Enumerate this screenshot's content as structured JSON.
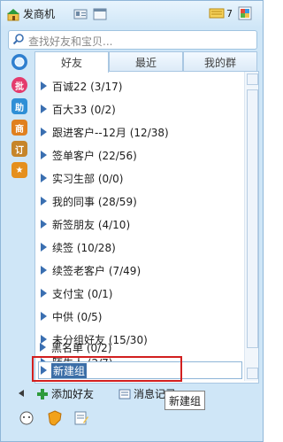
{
  "topbar": {
    "title": "发商机",
    "badge_count": "7"
  },
  "search": {
    "placeholder": "查找好友和宝贝..."
  },
  "side": {
    "pi_label": "批",
    "zhu_label": "助",
    "shang_label": "商",
    "gong_label": "订",
    "star_label": "★"
  },
  "tabs": [
    {
      "label": "好友"
    },
    {
      "label": "最近"
    },
    {
      "label": "我的群"
    }
  ],
  "groups": [
    {
      "label": "百诚22 (3/17)"
    },
    {
      "label": "百大33 (0/2)"
    },
    {
      "label": "跟进客户--12月 (12/38)"
    },
    {
      "label": "签单客户 (22/56)"
    },
    {
      "label": "实习生部 (0/0)"
    },
    {
      "label": "我的同事 (28/59)"
    },
    {
      "label": "新签朋友 (4/10)"
    },
    {
      "label": "续签 (10/28)"
    },
    {
      "label": "续签老客户 (7/49)"
    },
    {
      "label": "支付宝 (0/1)"
    },
    {
      "label": "中供 (0/5)"
    },
    {
      "label": "未分组好友 (15/30)"
    },
    {
      "label": "陌生人 (2/7)"
    },
    {
      "label": "黑名单 (0/2)"
    }
  ],
  "edit": {
    "value": "新建组"
  },
  "tooltip": {
    "text": "新建组"
  },
  "bottom": {
    "add_friend": "添加好友",
    "messages": "消息记录"
  },
  "colors": {
    "accent_blue": "#3a6fb1",
    "highlight_red": "#d21f1f"
  }
}
